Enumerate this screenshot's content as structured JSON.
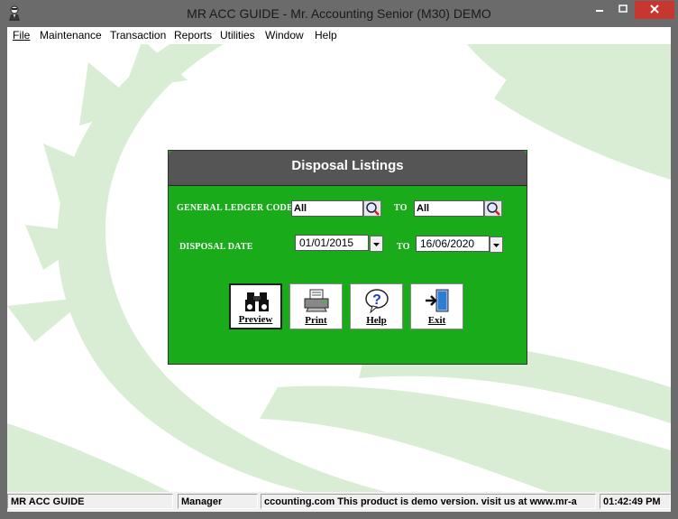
{
  "window": {
    "title": "MR ACC GUIDE - Mr. Accounting Senior (M30) DEMO"
  },
  "menu": [
    {
      "label": "File"
    },
    {
      "label": "Maintenance"
    },
    {
      "label": "Transaction"
    },
    {
      "label": "Reports"
    },
    {
      "label": "Utilities"
    },
    {
      "label": "Window"
    },
    {
      "label": "Help"
    }
  ],
  "dialog": {
    "title": "Disposal Listings",
    "gl_label": "GENERAL LEDGER CODE",
    "gl_from": "All",
    "to_label": "TO",
    "gl_to": "All",
    "date_label": "DISPOSAL DATE",
    "date_from": "01/01/2015",
    "date_to": "16/06/2020",
    "buttons": {
      "preview": "Preview",
      "print": "Print",
      "help": "Help",
      "exit": "Exit"
    }
  },
  "status": {
    "app": "MR ACC GUIDE",
    "user": "Manager",
    "message": "ccounting.com This product is demo version.  visit us at www.mr-a",
    "time": "01:42:49 PM"
  },
  "colors": {
    "dialog_bg": "#1aab1a",
    "dialog_header": "#555555",
    "close_button": "#c7372f",
    "watermark": "#d8edd4"
  }
}
